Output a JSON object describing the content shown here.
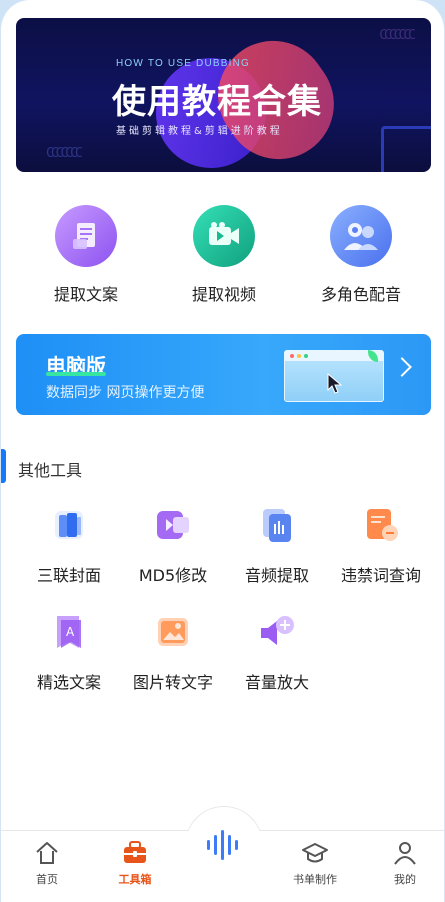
{
  "banner": {
    "subtitle": "HOW TO USE DUBBING",
    "title": "使用教程合集",
    "description": "基础剪辑教程&剪辑进阶教程",
    "decoration_top": "CCCCCCC",
    "decoration_bottom": "CCCCCCC"
  },
  "features": [
    {
      "label": "提取文案",
      "icon": "document-icon",
      "color": "#9b62f4"
    },
    {
      "label": "提取视频",
      "icon": "video-camera-icon",
      "color": "#17b98f"
    },
    {
      "label": "多角色配音",
      "icon": "people-voice-icon",
      "color": "#5a80f2"
    }
  ],
  "pc_banner": {
    "title": "电脑版",
    "description": "数据同步  网页操作更方便"
  },
  "section": {
    "title": "其他工具"
  },
  "tools": [
    {
      "label": "三联封面",
      "icon": "cover-icon"
    },
    {
      "label": "MD5修改",
      "icon": "md5-icon"
    },
    {
      "label": "音频提取",
      "icon": "audio-extract-icon"
    },
    {
      "label": "违禁词查询",
      "icon": "banned-word-icon"
    },
    {
      "label": "精选文案",
      "icon": "selected-copy-icon"
    },
    {
      "label": "图片转文字",
      "icon": "image-to-text-icon"
    },
    {
      "label": "音量放大",
      "icon": "volume-up-icon"
    }
  ],
  "nav": {
    "items": [
      {
        "label": "首页",
        "icon": "home-icon"
      },
      {
        "label": "工具箱",
        "icon": "toolbox-icon",
        "active": true
      },
      {
        "label": "书单制作",
        "icon": "graduation-cap-icon"
      },
      {
        "label": "我的",
        "icon": "user-icon"
      }
    ],
    "center_icon": "voice-wave-icon"
  },
  "colors": {
    "accent": "#1677ff",
    "active_nav": "#e8551b"
  }
}
